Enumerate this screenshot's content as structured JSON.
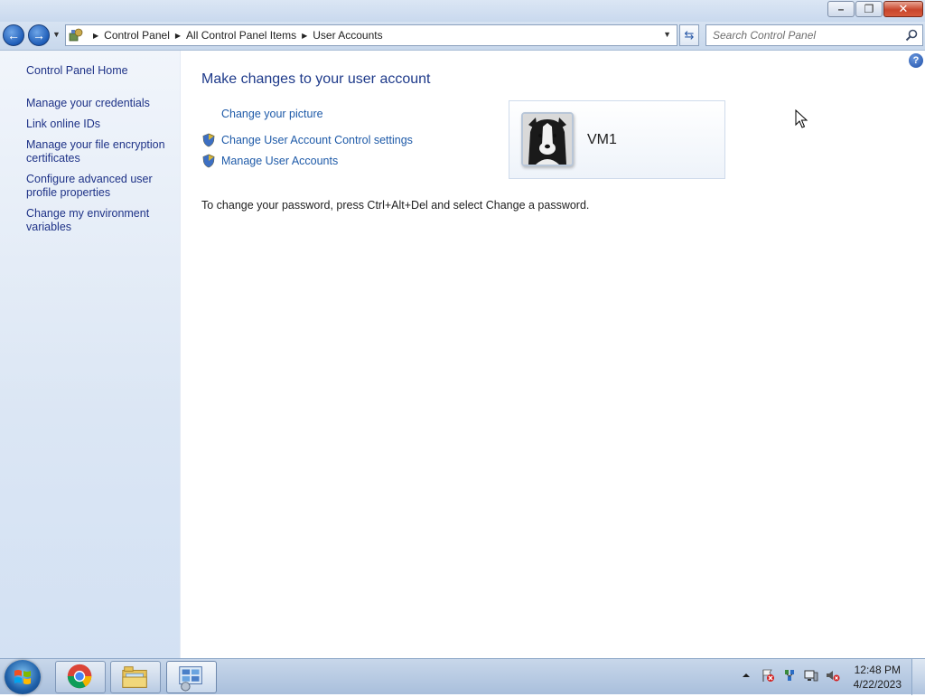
{
  "address": {
    "crumbs": [
      "Control Panel",
      "All Control Panel Items",
      "User Accounts"
    ]
  },
  "search": {
    "placeholder": "Search Control Panel"
  },
  "sidebar": {
    "home": "Control Panel Home",
    "tasks": [
      "Manage your credentials",
      "Link online IDs",
      "Manage your file encryption certificates",
      "Configure advanced user profile properties",
      "Change my environment variables"
    ]
  },
  "main": {
    "heading": "Make changes to your user account",
    "tasks": [
      "Change your picture",
      "Change User Account Control settings",
      "Manage User Accounts"
    ],
    "password_note": "To change your password, press Ctrl+Alt+Del and select Change a password.",
    "user": {
      "name": "VM1"
    }
  },
  "taskbar": {
    "time": "12:48 PM",
    "date": "4/22/2023",
    "apps": [
      "chrome-icon",
      "file-explorer-icon",
      "control-panel-icon"
    ]
  },
  "colors": {
    "link": "#1e3287",
    "heading": "#1e3a8a",
    "sidebar": "#dbe6f4"
  },
  "icons": {
    "window": [
      "minimize-icon",
      "restore-icon",
      "close-icon"
    ],
    "tray": [
      "show-hidden-icons-icon",
      "action-center-icon",
      "network-icon",
      "monitor-icon",
      "volume-muted-icon"
    ]
  }
}
